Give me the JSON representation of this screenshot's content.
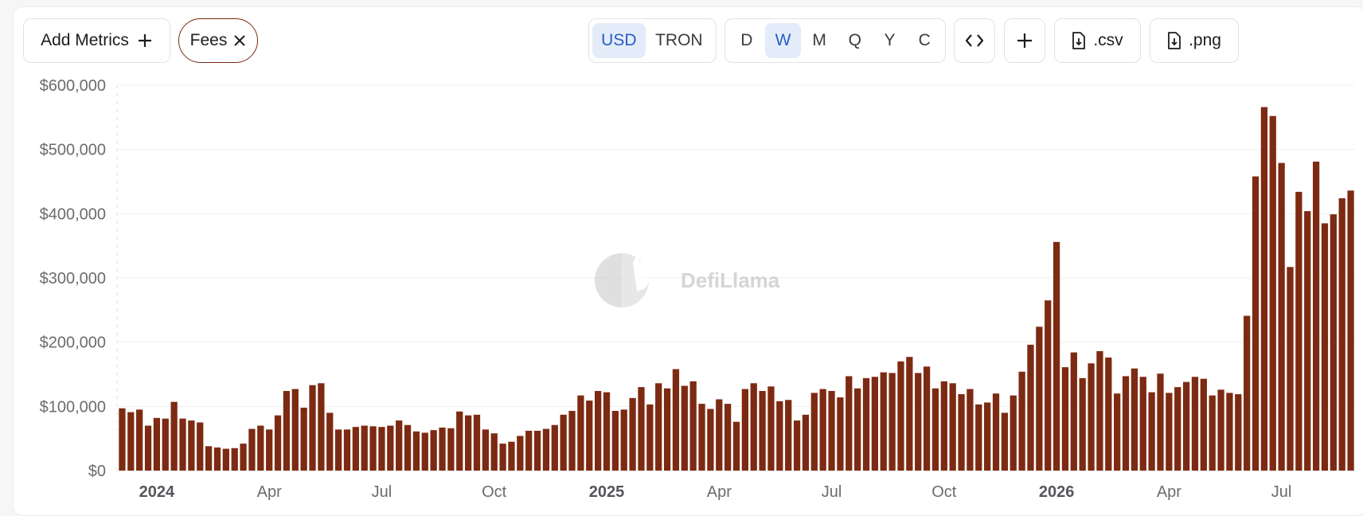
{
  "toolbar": {
    "add_metrics": "Add Metrics",
    "fees_chip": "Fees",
    "currency": [
      "USD",
      "TRON"
    ],
    "currency_selected": "USD",
    "periods": [
      "D",
      "W",
      "M",
      "Q",
      "Y",
      "C"
    ],
    "period_selected": "W",
    "embed_icon": "code-icon",
    "add_icon": "plus-icon",
    "csv_label": ".csv",
    "png_label": ".png"
  },
  "watermark": "DefiLlama",
  "colors": {
    "bar": "#7d2a12",
    "accent": "#2a5cc5"
  },
  "chart_data": {
    "type": "bar",
    "title": "",
    "xlabel": "",
    "ylabel": "",
    "ylim": [
      0,
      600000
    ],
    "yticks": [
      "$0",
      "$100,000",
      "$200,000",
      "$300,000",
      "$400,000",
      "$500,000",
      "$600,000"
    ],
    "xticks": [
      {
        "label": "2024",
        "index": 4.5,
        "year": true
      },
      {
        "label": "Apr",
        "index": 17.5,
        "year": false
      },
      {
        "label": "Jul",
        "index": 30.5,
        "year": false
      },
      {
        "label": "Oct",
        "index": 43.5,
        "year": false
      },
      {
        "label": "2025",
        "index": 56.5,
        "year": true
      },
      {
        "label": "Apr",
        "index": 69.5,
        "year": false
      },
      {
        "label": "Jul",
        "index": 82.5,
        "year": false
      },
      {
        "label": "Oct",
        "index": 95.5,
        "year": false
      },
      {
        "label": "2026",
        "index": 108.5,
        "year": true
      },
      {
        "label": "Apr",
        "index": 121.5,
        "year": false
      },
      {
        "label": "Jul",
        "index": 134.5,
        "year": false
      }
    ],
    "series": [
      {
        "values": [
          97000,
          91000,
          95000,
          70000,
          82000,
          81000,
          107000,
          81000,
          78000,
          75000,
          38000,
          36000,
          34000,
          35000,
          42000,
          65000,
          70000,
          64000,
          86000,
          124000,
          127000,
          98000,
          133000,
          136000,
          90000,
          64000,
          64000,
          68000,
          70000,
          69000,
          68000,
          70000,
          78000,
          71000,
          61000,
          59000,
          63000,
          67000,
          66000,
          92000,
          86000,
          87000,
          64000,
          58000,
          42000,
          45000,
          54000,
          62000,
          62000,
          65000,
          71000,
          87000,
          93000,
          117000,
          109000,
          124000,
          122000,
          93000,
          95000,
          113000,
          130000,
          103000,
          136000,
          128000,
          158000,
          132000,
          139000,
          104000,
          96000,
          111000,
          104000,
          76000,
          127000,
          136000,
          124000,
          131000,
          108000,
          110000,
          78000,
          87000,
          121000,
          127000,
          124000,
          114000,
          147000,
          128000,
          144000,
          146000,
          153000,
          152000,
          170000,
          177000,
          152000,
          162000,
          128000,
          139000,
          136000,
          119000,
          127000,
          103000,
          106000,
          120000,
          90000,
          117000,
          154000,
          196000,
          224000,
          265000,
          356000,
          161000,
          184000,
          144000,
          167000,
          186000,
          176000,
          120000,
          147000,
          159000,
          146000,
          122000,
          151000,
          121000,
          130000,
          138000,
          146000,
          143000,
          117000,
          126000,
          121000,
          119000,
          241000,
          458000,
          566000,
          552000,
          479000,
          317000,
          434000,
          404000,
          481000,
          385000,
          399000,
          424000,
          436000
        ]
      }
    ]
  }
}
